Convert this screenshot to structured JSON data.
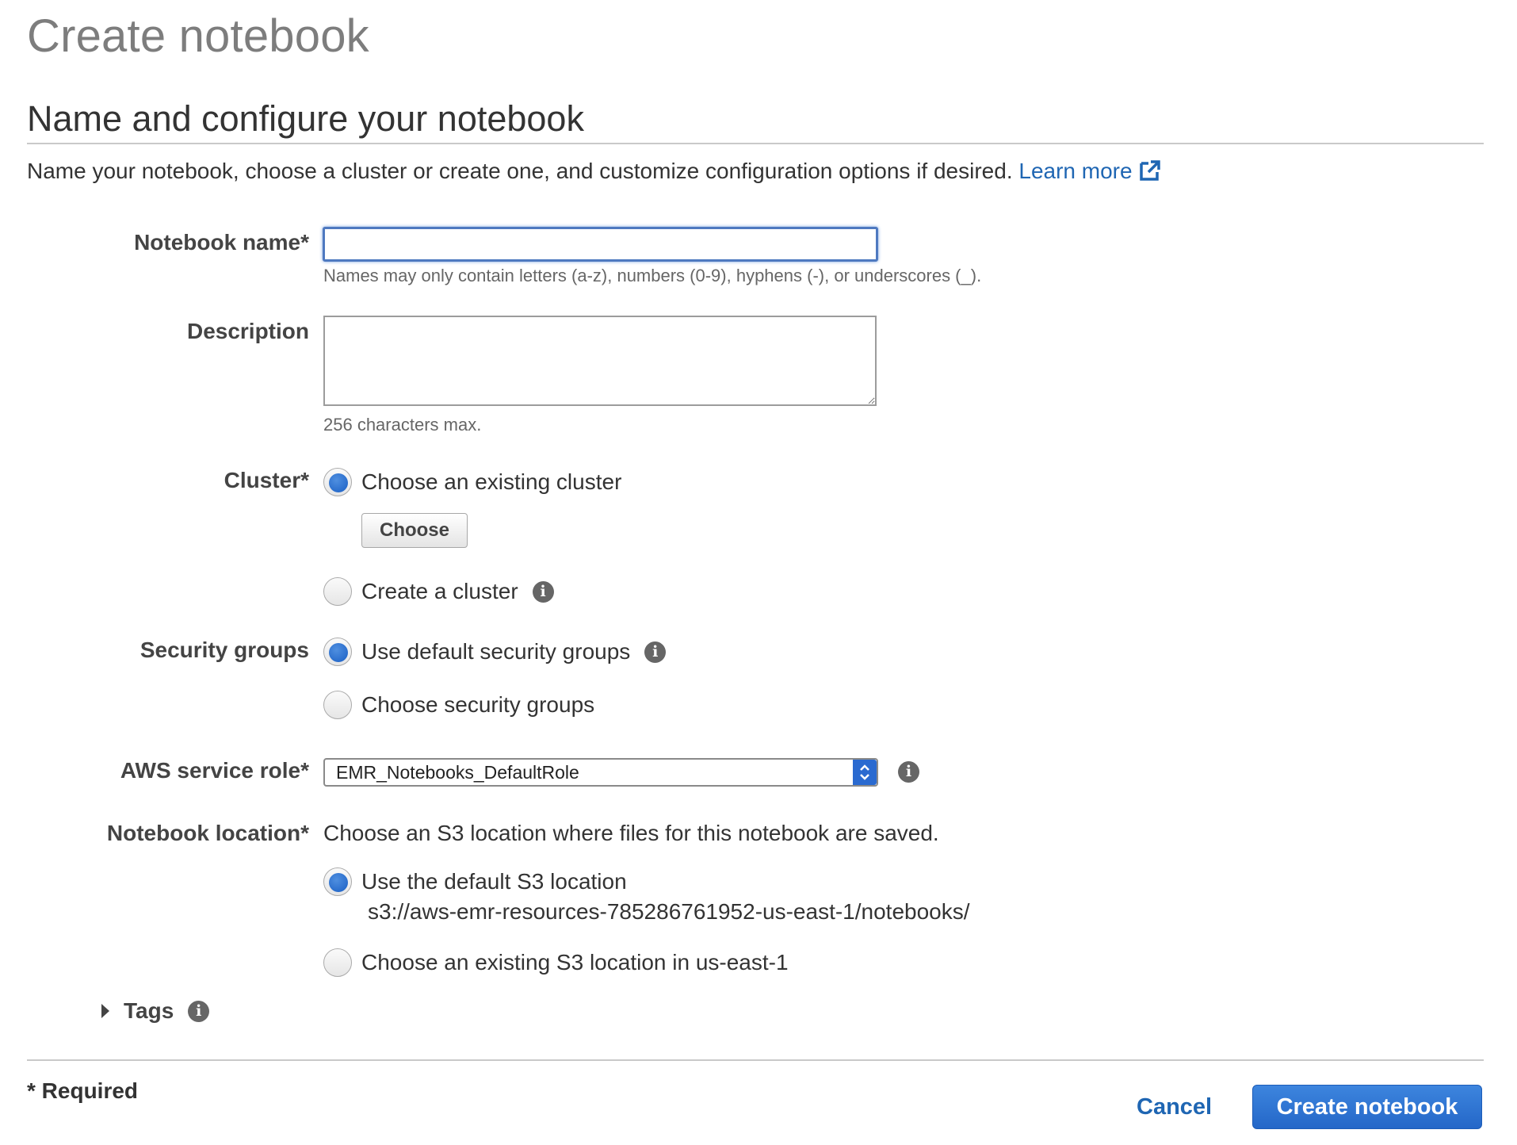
{
  "page": {
    "title": "Create notebook",
    "section_title": "Name and configure your notebook",
    "intro_text": "Name your notebook, choose a cluster or create one, and customize configuration options if desired.",
    "learn_more": "Learn more"
  },
  "notebook_name": {
    "label": "Notebook name*",
    "value": "",
    "help": "Names may only contain letters (a-z), numbers (0-9), hyphens (-), or underscores (_)."
  },
  "description": {
    "label": "Description",
    "value": "",
    "help": "256 characters max."
  },
  "cluster": {
    "label": "Cluster*",
    "option_existing": "Choose an existing cluster",
    "choose_button": "Choose",
    "option_create": "Create a cluster",
    "selected": "existing"
  },
  "security_groups": {
    "label": "Security groups",
    "option_default": "Use default security groups",
    "option_choose": "Choose security groups",
    "selected": "default"
  },
  "service_role": {
    "label": "AWS service role*",
    "value": "EMR_Notebooks_DefaultRole"
  },
  "location": {
    "label": "Notebook location*",
    "description": "Choose an S3 location where files for this notebook are saved.",
    "option_default": "Use the default S3 location",
    "default_path": "s3://aws-emr-resources-785286761952-us-east-1/notebooks/",
    "option_existing": "Choose an existing S3 location in us-east-1",
    "selected": "default"
  },
  "tags": {
    "label": "Tags"
  },
  "footer": {
    "required_note": "* Required",
    "cancel": "Cancel",
    "create": "Create notebook"
  },
  "colors": {
    "link": "#1f66b3",
    "primary_button": "#2a6ad0",
    "title_gray": "#7d7d7d",
    "radio_selected": "#1a5fc4"
  },
  "icons": [
    "external-link-icon",
    "info-icon",
    "caret-right-icon",
    "select-updown-icon"
  ]
}
